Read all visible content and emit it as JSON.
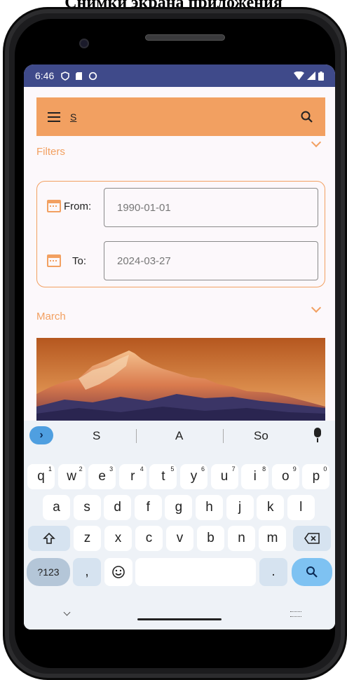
{
  "caption": "Снимки экрана приложения",
  "statusbar": {
    "time": "6:46"
  },
  "search": {
    "query": "S"
  },
  "filters": {
    "title": "Filters",
    "from_label": "From:",
    "from_value": "1990-01-01",
    "to_label": "To:",
    "to_value": "2024-03-27"
  },
  "month_section": {
    "title": "March"
  },
  "keyboard": {
    "suggestions": [
      "S",
      "A",
      "So"
    ],
    "row1": [
      {
        "k": "q",
        "n": "1"
      },
      {
        "k": "w",
        "n": "2"
      },
      {
        "k": "e",
        "n": "3"
      },
      {
        "k": "r",
        "n": "4"
      },
      {
        "k": "t",
        "n": "5"
      },
      {
        "k": "y",
        "n": "6"
      },
      {
        "k": "u",
        "n": "7"
      },
      {
        "k": "i",
        "n": "8"
      },
      {
        "k": "o",
        "n": "9"
      },
      {
        "k": "p",
        "n": "0"
      }
    ],
    "row2": [
      "a",
      "s",
      "d",
      "f",
      "g",
      "h",
      "j",
      "k",
      "l"
    ],
    "row3": [
      "z",
      "x",
      "c",
      "v",
      "b",
      "n",
      "m"
    ],
    "symbols_label": "?123",
    "comma": ",",
    "period": "."
  },
  "colors": {
    "accent": "#f2a061",
    "statusbar": "#3f4a8a",
    "enter_key": "#7ec2f2"
  }
}
